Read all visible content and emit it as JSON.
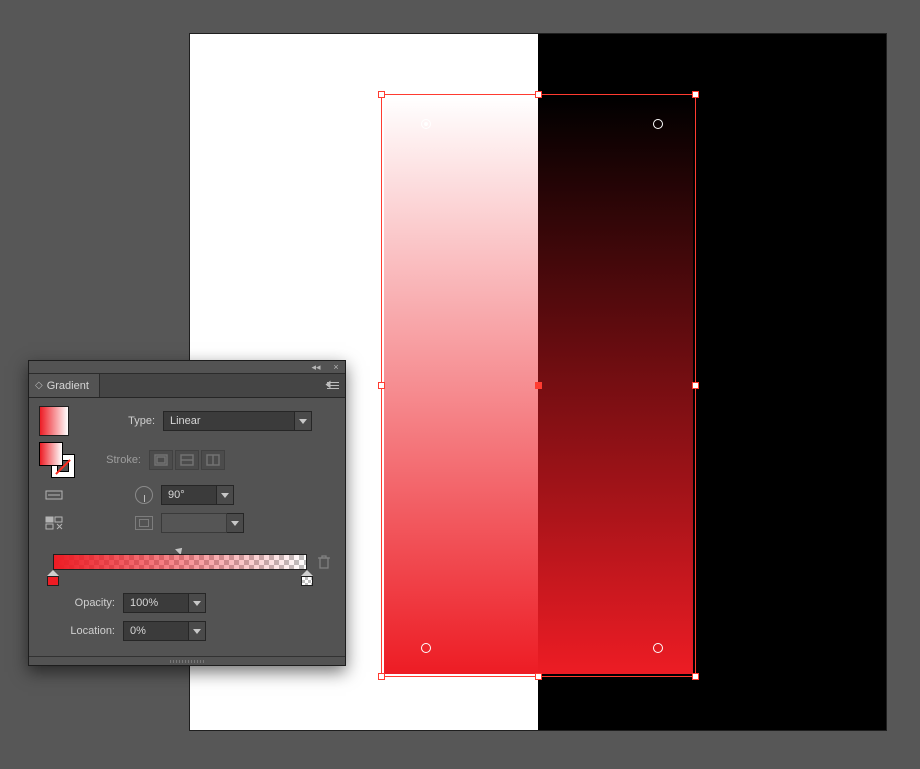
{
  "panel": {
    "title": "Gradient",
    "type_label": "Type:",
    "type_value": "Linear",
    "stroke_label": "Stroke:",
    "angle_value": "90°",
    "aspect_value": "",
    "opacity_label": "Opacity:",
    "opacity_value": "100%",
    "location_label": "Location:",
    "location_value": "0%"
  },
  "gradient": {
    "angle_deg": 90,
    "stops": [
      {
        "color": "#ed1c24",
        "opacity": 100,
        "location": 0
      },
      {
        "color": "#ed1c24",
        "opacity": 0,
        "location": 100
      }
    ],
    "midpoint": 50
  },
  "colors": {
    "accent": "#ed1c24",
    "panel_bg": "#535353",
    "selection": "#ff3b30"
  },
  "icons": {
    "collapse": "◂◂",
    "close": "×",
    "tab_glyph": "◇"
  }
}
